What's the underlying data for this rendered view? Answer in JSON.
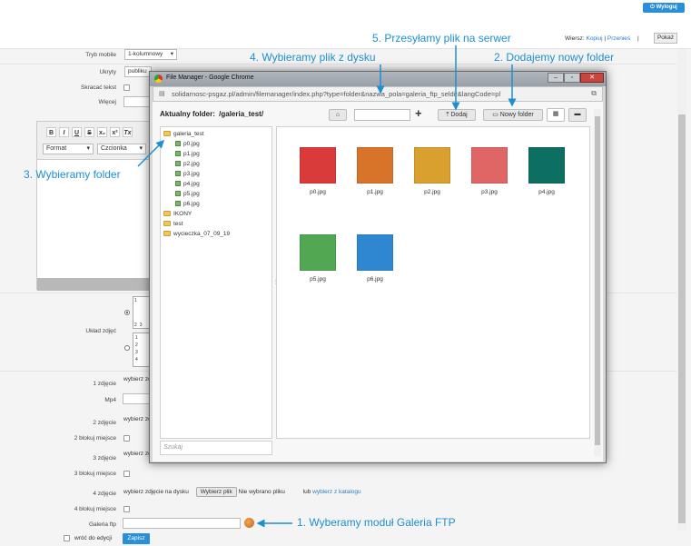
{
  "header": {
    "logout_label": "Wyloguj"
  },
  "lang": {
    "label": "Wiersz:",
    "copy": "Kopiuj",
    "move": "Przenieś",
    "show": "Pokaż"
  },
  "form": {
    "tryb_mobile": {
      "label": "Tryb mobile",
      "value": "1-kolumnowy"
    },
    "ukryty": {
      "label": "Ukryty",
      "value": "publiku"
    },
    "skracac": {
      "label": "Skracać tekst"
    },
    "wiecej": {
      "label": "Więcej"
    },
    "editor": {
      "format": "Format",
      "font": "Czcionka",
      "b": "B",
      "i": "I",
      "u": "U",
      "s": "S",
      "x2": "x₂",
      "x_2": "x²",
      "tx": "Tx"
    },
    "uklad": {
      "label": "Układ zdjęć",
      "n1": "1",
      "n2": "2",
      "n3": "3",
      "s1": "1",
      "s2": "2",
      "s3": "3",
      "s4": "4"
    },
    "z1": {
      "label": "1 zdjęcie",
      "pick": "wybierz zd"
    },
    "mp4": {
      "label": "Mp4"
    },
    "z2": {
      "label": "2 zdjęcie",
      "pick": "wybierz zd"
    },
    "b2": {
      "label": "2 blokuj miejsce"
    },
    "z3": {
      "label": "3 zdjęcie",
      "pick": "wybierz zd"
    },
    "b3": {
      "label": "3 blokuj miejsce"
    },
    "z4": {
      "label": "4 zdjęcie",
      "pick": "wybierz zdjęcie na dysku",
      "button": "Wybierz plik",
      "none": "Nie wybrano pliku",
      "or": "lub",
      "catalog": "wybierz z katalogu"
    },
    "b4": {
      "label": "4 blokuj miejsce"
    },
    "galeria": {
      "label": "Galeria ftp"
    },
    "return": {
      "label": "wróć do edycji",
      "save": "Zapisz"
    }
  },
  "file_manager": {
    "window_title": "File Manager - Google Chrome",
    "url": "solidarnosc-psgaz.pl/admin/filemanager/index.php?type=folder&nazwa_pola=galeria_ftp_seldir&langCode=pl",
    "current_folder_label": "Aktualny folder:",
    "current_folder": "/galeria_test/",
    "add_label": "Dodaj",
    "new_folder_label": "Nowy folder",
    "search_placeholder": "Szukaj",
    "tree": [
      "galeria_test",
      "p0.jpg",
      "p1.jpg",
      "p2.jpg",
      "p3.jpg",
      "p4.jpg",
      "p5.jpg",
      "p6.jpg",
      "IKONY",
      "test",
      "wycieczka_07_09_19"
    ],
    "files": [
      {
        "name": "p0.jpg",
        "color": "#d93b3b"
      },
      {
        "name": "p1.jpg",
        "color": "#d8732a"
      },
      {
        "name": "p2.jpg",
        "color": "#d9a030"
      },
      {
        "name": "p3.jpg",
        "color": "#e06565"
      },
      {
        "name": "p4.jpg",
        "color": "#0d6f62"
      },
      {
        "name": "p5.jpg",
        "color": "#52a852"
      },
      {
        "name": "p6.jpg",
        "color": "#2f87d1"
      }
    ]
  },
  "annotations": {
    "a1": "1. Wyberamy moduł Galeria FTP",
    "a2": "2. Dodajemy nowy folder",
    "a3": "3. Wybieramy folder",
    "a4": "4. Wybieramy plik z dysku",
    "a5": "5. Przesyłamy plik na serwer"
  }
}
